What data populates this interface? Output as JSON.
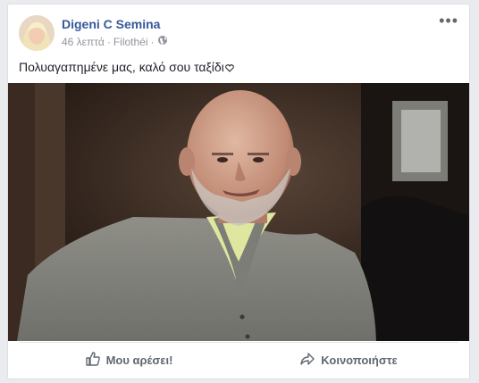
{
  "post": {
    "author_name": "Digeni C Semina",
    "time": "46 λεπτά",
    "separator": "·",
    "location": "Filothéi",
    "text": "Πολυαγαπημένε μας, καλό σου ταξίδι"
  },
  "actions": {
    "like_label": "Μου αρέσει!",
    "share_label": "Κοινοποιήστε"
  },
  "icons": [
    "globe-icon",
    "more-options-icon",
    "like-icon",
    "share-icon",
    "heart-emoji-icon"
  ]
}
